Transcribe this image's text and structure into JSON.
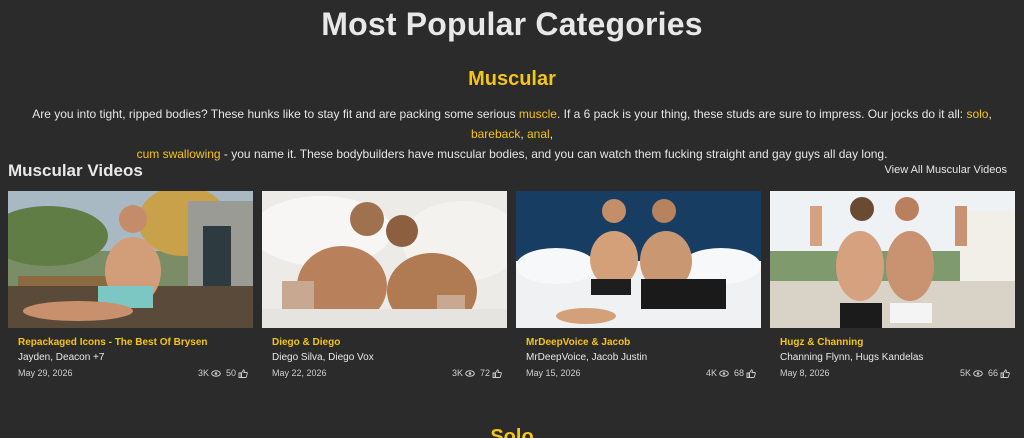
{
  "page": {
    "title": "Most Popular Categories"
  },
  "category": {
    "title": "Muscular",
    "desc_1": "Are you into tight, ripped bodies? These hunks like to stay fit and are packing some serious ",
    "link_muscle": "muscle",
    "desc_2": ". If a 6 pack is your thing, these studs are sure to impress. Our jocks do it all: ",
    "link_solo": "solo",
    "sep_1": ", ",
    "link_bareback": "bareback",
    "sep_2": ", ",
    "link_anal": "anal",
    "sep_3": ",",
    "link_cum": "cum swallowing",
    "desc_3": " - you name it. These bodybuilders have muscular bodies, and you can watch them fucking straight and gay guys all day long."
  },
  "section": {
    "title": "Muscular Videos",
    "view_all": "View All Muscular Videos"
  },
  "videos": [
    {
      "title": "Repackaged Icons - The Best Of Brysen",
      "models": "Jayden, Deacon +7",
      "date": "May 29, 2026",
      "views": "3K",
      "likes": "50"
    },
    {
      "title": "Diego & Diego",
      "models": "Diego Silva, Diego Vox",
      "date": "May 22, 2026",
      "views": "3K",
      "likes": "72"
    },
    {
      "title": "MrDeepVoice & Jacob",
      "models": "MrDeepVoice, Jacob Justin",
      "date": "May 15, 2026",
      "views": "4K",
      "likes": "68"
    },
    {
      "title": "Hugz & Channing",
      "models": "Channing Flynn, Hugs Kandelas",
      "date": "May 8, 2026",
      "views": "5K",
      "likes": "66"
    }
  ],
  "next_category": {
    "title": "Solo"
  },
  "colors": {
    "background": "#2b2b2b",
    "accent": "#f5c518",
    "text": "#e6e6e6"
  },
  "icons": {
    "views": "eye-icon",
    "likes": "thumbs-up-icon"
  }
}
